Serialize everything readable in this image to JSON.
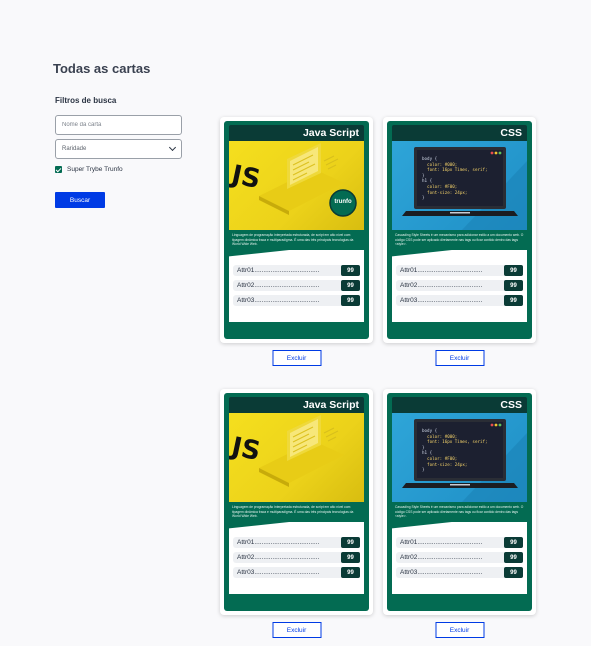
{
  "page": {
    "title": "Todas as cartas"
  },
  "filters": {
    "title": "Filtros de busca",
    "name_placeholder": "Nome da carta",
    "rarity_value": "Raridade",
    "trunfo_label": "Super Trybe Trunfo",
    "search_label": "Buscar"
  },
  "colors": {
    "brand_green": "#036b52",
    "dark_green": "#0a3b36",
    "accent_blue": "#003be5"
  },
  "cards": [
    {
      "name": "Java Script",
      "image": "javascript-laptop-illustration",
      "trunfo_badge": "trunfo",
      "description": "Linguagem de programação interpretada estruturada, de script em alto nível com tipagem dinâmica fraca e multiparadigma. É uma das três principais tecnologias da World Wide Web.",
      "attrs": [
        {
          "label": "Attr01....................................",
          "value": "99"
        },
        {
          "label": "Attr02....................................",
          "value": "99"
        },
        {
          "label": "Attr03....................................",
          "value": "99"
        }
      ],
      "delete_label": "Excluir"
    },
    {
      "name": "CSS",
      "image": "css-laptop-code-illustration",
      "description": "Cascading Style Sheets é um mecanismo para adicionar estilo a um documento web. O código CSS pode ser aplicado diretamente nas tags ou ficar contido dentro das tags <style>.",
      "code_lines": [
        "body {",
        "  color: #000;",
        "  font: 16px Times, serif;",
        "}",
        "h1 {",
        "  color: #F00;",
        "  font-size: 24px;",
        "}"
      ],
      "attrs": [
        {
          "label": "Attr01....................................",
          "value": "99"
        },
        {
          "label": "Attr02....................................",
          "value": "99"
        },
        {
          "label": "Attr03....................................",
          "value": "99"
        }
      ],
      "delete_label": "Excluir"
    },
    {
      "name": "Java Script",
      "image": "javascript-laptop-illustration",
      "description": "Linguagem de programação interpretada estruturada, de script em alto nível com tipagem dinâmica fraca e multiparadigma. É uma das três principais tecnologias da World Wide Web.",
      "attrs": [
        {
          "label": "Attr01....................................",
          "value": "99"
        },
        {
          "label": "Attr02....................................",
          "value": "99"
        },
        {
          "label": "Attr03....................................",
          "value": "99"
        }
      ],
      "delete_label": "Excluir"
    },
    {
      "name": "CSS",
      "image": "css-laptop-code-illustration",
      "description": "Cascading Style Sheets é um mecanismo para adicionar estilo a um documento web. O código CSS pode ser aplicado diretamente nas tags ou ficar contido dentro das tags <style>.",
      "code_lines": [
        "body {",
        "  color: #000;",
        "  font: 16px Times, serif;",
        "}",
        "h1 {",
        "  color: #F00;",
        "  font-size: 24px;",
        "}"
      ],
      "attrs": [
        {
          "label": "Attr01....................................",
          "value": "99"
        },
        {
          "label": "Attr02....................................",
          "value": "99"
        },
        {
          "label": "Attr03....................................",
          "value": "99"
        }
      ],
      "delete_label": "Excluir"
    }
  ]
}
